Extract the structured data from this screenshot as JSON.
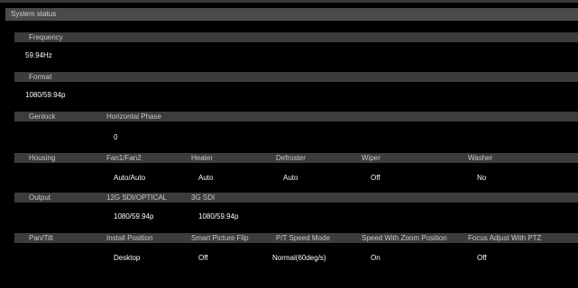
{
  "title": "System status",
  "frequency": {
    "header": "Frequency",
    "value": "59.94Hz"
  },
  "format": {
    "header": "Format",
    "value": "1080/59.94p"
  },
  "genlock": {
    "header": "Genlock",
    "cols": [
      "Horizontal Phase"
    ],
    "values": [
      "0"
    ]
  },
  "housing": {
    "header": "Housing",
    "cols": [
      "Fan1/Fan2",
      "Heater",
      "Defroster",
      "Wiper",
      "Washer"
    ],
    "values": [
      "Auto/Auto",
      "Auto",
      "Auto",
      "Off",
      "No"
    ]
  },
  "output": {
    "header": "Output",
    "cols": [
      "12G SDI/OPTICAL",
      "3G SDI"
    ],
    "values": [
      "1080/59.94p",
      "1080/59.94p"
    ]
  },
  "pantilt": {
    "header": "Pan/Tilt",
    "cols": [
      "Install Position",
      "Smart Picture Flip",
      "P/T Speed Mode",
      "Speed With Zoom Position",
      "Focus Adjust With PTZ"
    ],
    "values": [
      "Desktop",
      "Off",
      "Normal(60deg/s)",
      "On",
      "Off"
    ]
  }
}
